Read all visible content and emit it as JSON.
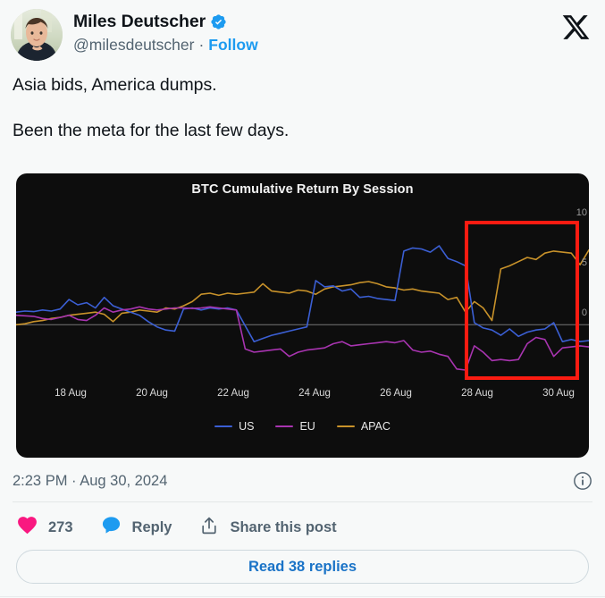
{
  "post": {
    "author_name": "Miles Deutscher",
    "handle": "@milesdeutscher",
    "separator": "·",
    "follow_label": "Follow",
    "verified_icon": "verified-badge-icon",
    "avatar_icon": "user-avatar",
    "brand_icon": "x-logo-icon",
    "text_lines": [
      "Asia bids, America dumps.",
      "Been the meta for the last few days."
    ],
    "timestamp": "2:23 PM · Aug 30, 2024",
    "info_icon": "info-circle-icon"
  },
  "actions": {
    "like_icon": "heart-icon",
    "like_count": "273",
    "reply_icon": "comment-bubble-icon",
    "reply_label": "Reply",
    "share_icon": "share-arrow-icon",
    "share_label": "Share this post",
    "read_replies_label": "Read 38 replies"
  },
  "colors": {
    "us": "#3b5fd4",
    "eu": "#a834b0",
    "apac": "#c8922a",
    "highlight_box": "#fb1b11",
    "link": "#1d9bf0",
    "like": "#f91880",
    "reply": "#1d9bf0",
    "chart_bg": "#0d0d0d"
  },
  "chart_data": {
    "type": "line",
    "title": "BTC Cumulative Return By Session",
    "xlabel": "",
    "ylabel": "",
    "grid": false,
    "legend_position": "bottom",
    "zero_line": true,
    "xtick_labels": [
      "18 Aug",
      "20 Aug",
      "22 Aug",
      "24 Aug",
      "26 Aug",
      "28 Aug",
      "30 Aug"
    ],
    "ytick_labels": [
      "10",
      "5",
      "0"
    ],
    "ylim": [
      -6,
      12
    ],
    "xlim": [
      "17 Aug",
      "31 Aug"
    ],
    "annotations": [
      {
        "type": "rect",
        "label": "highlight-region",
        "x_range": [
          "28 Aug",
          "31 Aug"
        ],
        "color": "#fb1b11"
      }
    ],
    "series": [
      {
        "name": "US",
        "color": "#3b5fd4",
        "values": [
          1.2,
          1.3,
          1.25,
          1.4,
          1.3,
          1.5,
          2.4,
          1.9,
          2.1,
          1.6,
          2.6,
          1.8,
          1.5,
          1.2,
          0.9,
          0.3,
          -0.2,
          -0.5,
          -0.6,
          1.5,
          1.6,
          1.4,
          1.6,
          1.5,
          1.6,
          1.4,
          -0.1,
          -1.6,
          -1.3,
          -1.0,
          -0.8,
          -0.6,
          -0.4,
          -0.2,
          4.2,
          3.6,
          3.7,
          3.2,
          3.4,
          2.6,
          2.7,
          2.5,
          2.4,
          2.3,
          7.0,
          7.3,
          7.2,
          6.9,
          7.5,
          6.3,
          6.0,
          5.6,
          0.2,
          -0.3,
          -0.5,
          -1.0,
          -0.4,
          -1.1,
          -0.7,
          -0.5,
          -0.4,
          0.2,
          -1.6,
          -1.4,
          -1.6,
          -1.5
        ]
      },
      {
        "name": "EU",
        "color": "#a834b0",
        "values": [
          0.9,
          0.85,
          0.8,
          0.6,
          0.5,
          0.7,
          0.9,
          0.5,
          0.4,
          0.9,
          1.6,
          1.2,
          1.4,
          1.5,
          1.7,
          1.5,
          1.4,
          1.5,
          1.6,
          1.6,
          1.55,
          1.6,
          1.7,
          1.6,
          1.5,
          1.4,
          -2.3,
          -2.6,
          -2.5,
          -2.4,
          -2.3,
          -3.0,
          -2.6,
          -2.4,
          -2.3,
          -2.2,
          -1.8,
          -1.6,
          -2.0,
          -1.9,
          -1.8,
          -1.7,
          -1.6,
          -1.7,
          -1.5,
          -2.4,
          -2.6,
          -2.5,
          -2.8,
          -3.0,
          -4.2,
          -4.3,
          -2.0,
          -2.6,
          -3.4,
          -3.3,
          -3.4,
          -3.3,
          -1.8,
          -1.2,
          -1.4,
          -3.0,
          -2.2,
          -2.1,
          -2.0,
          -2.1
        ]
      },
      {
        "name": "APAC",
        "color": "#c8922a",
        "values": [
          0.0,
          0.1,
          0.3,
          0.4,
          0.6,
          0.7,
          0.9,
          1.0,
          1.1,
          1.2,
          1.0,
          0.3,
          1.1,
          1.2,
          1.4,
          1.3,
          1.2,
          1.6,
          1.5,
          1.8,
          2.2,
          2.9,
          3.0,
          2.8,
          3.0,
          2.9,
          3.0,
          3.1,
          3.9,
          3.2,
          3.1,
          3.0,
          3.3,
          3.2,
          2.9,
          3.4,
          3.6,
          3.7,
          3.8,
          4.0,
          4.1,
          3.9,
          3.6,
          3.5,
          3.3,
          3.4,
          3.2,
          3.1,
          3.0,
          2.4,
          2.6,
          1.2,
          2.2,
          1.6,
          0.4,
          5.3,
          5.6,
          6.0,
          6.4,
          6.2,
          6.8,
          7.0,
          6.9,
          6.8,
          5.7,
          7.1
        ]
      }
    ]
  }
}
